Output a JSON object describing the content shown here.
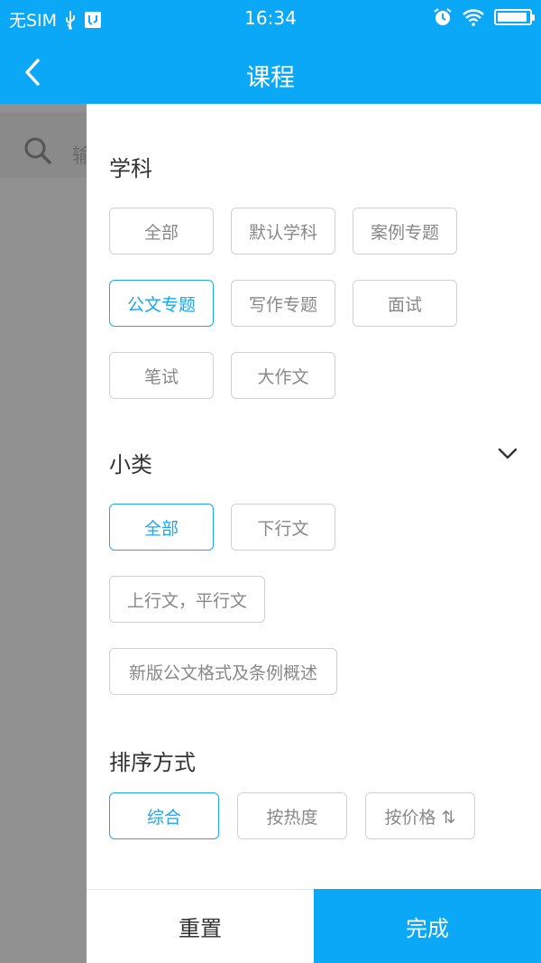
{
  "status_bar": {
    "carrier": "无SIM",
    "time": "16:34",
    "battery_level": 0.95
  },
  "nav": {
    "title": "课程"
  },
  "background": {
    "search_text": "输"
  },
  "filter": {
    "subject": {
      "title": "学科",
      "options": [
        "全部",
        "默认学科",
        "案例专题",
        "公文专题",
        "写作专题",
        "面试",
        "笔试",
        "大作文"
      ],
      "selected": "公文专题"
    },
    "subcategory": {
      "title": "小类",
      "options": [
        "全部",
        "下行文",
        "上行文，平行文",
        "新版公文格式及条例概述"
      ],
      "selected": "全部"
    },
    "sort": {
      "title": "排序方式",
      "options": [
        "综合",
        "按热度",
        "按价格 ⇅"
      ],
      "selected": "综合"
    }
  },
  "buttons": {
    "reset": "重置",
    "done": "完成"
  },
  "colors": {
    "accent": "#0aa8f7",
    "selected_chip": "#1ba7f0",
    "overlay": "#909090"
  }
}
